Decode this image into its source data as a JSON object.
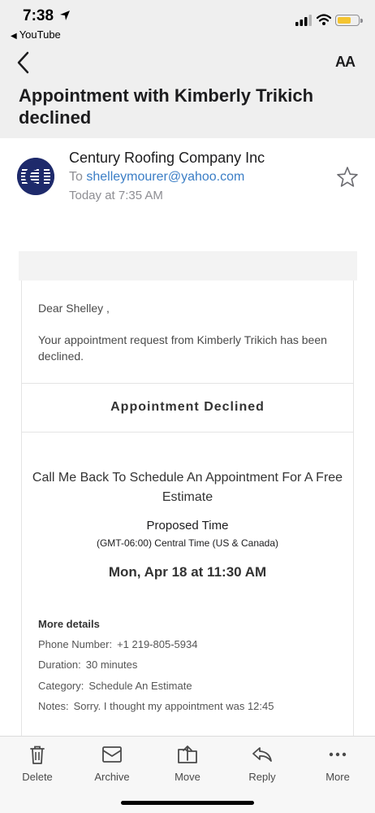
{
  "status_bar": {
    "time": "7:38",
    "back_app": "YouTube"
  },
  "header": {
    "font_button": "AA",
    "subject": "Appointment with Kimberly Trikich declined"
  },
  "sender": {
    "avatar_text": "CI",
    "name": "Century Roofing Company Inc",
    "to_label": "To",
    "to_address": "shelleymourer@yahoo.com",
    "date": "Today at 7:35 AM"
  },
  "body": {
    "greeting": "Dear Shelley ,",
    "message": "Your appointment request from Kimberly Trikich has been declined.",
    "declined_title": "Appointment Declined",
    "appointment_title": "Call Me Back To Schedule An Appointment For A Free Estimate",
    "proposed_label": "Proposed Time",
    "timezone": "(GMT-06:00) Central Time (US & Canada)",
    "datetime": "Mon, Apr 18 at 11:30 AM",
    "more_details_heading": "More details",
    "details": [
      {
        "label": "Phone Number:",
        "value": "+1 219-805-5934"
      },
      {
        "label": "Duration:",
        "value": "30 minutes"
      },
      {
        "label": "Category:",
        "value": "Schedule An Estimate"
      },
      {
        "label": "Notes:",
        "value": "Sorry. I thought my appointment was 12:45"
      }
    ]
  },
  "toolbar": {
    "delete": "Delete",
    "archive": "Archive",
    "move": "Move",
    "reply": "Reply",
    "more": "More"
  },
  "colors": {
    "link": "#3b7ec6",
    "battery": "#f4c430",
    "avatar_bg": "#1e2a6b"
  }
}
